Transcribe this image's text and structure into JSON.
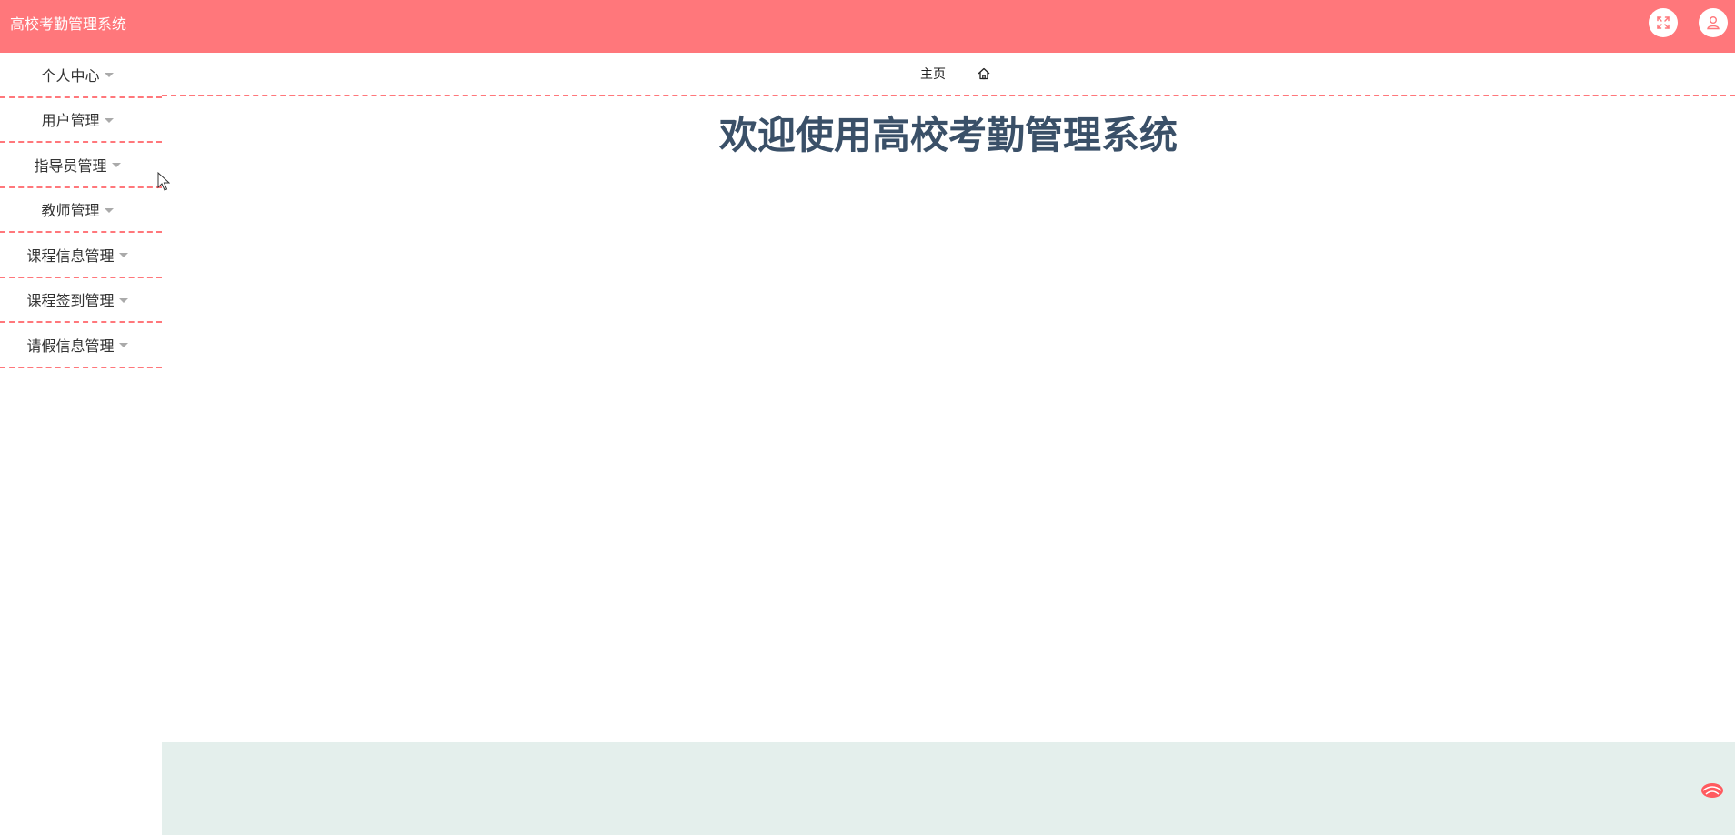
{
  "app": {
    "title": "高校考勤管理系统"
  },
  "header": {
    "fullscreen_icon": "fullscreen-icon",
    "user_icon": "user-icon"
  },
  "sidebar": {
    "items": [
      {
        "label": "个人中心"
      },
      {
        "label": "用户管理"
      },
      {
        "label": "指导员管理"
      },
      {
        "label": "教师管理"
      },
      {
        "label": "课程信息管理"
      },
      {
        "label": "课程签到管理"
      },
      {
        "label": "请假信息管理"
      }
    ]
  },
  "breadcrumb": {
    "home_label": "主页",
    "home_icon": "home-icon"
  },
  "main": {
    "welcome": "欢迎使用高校考勤管理系统"
  },
  "colors": {
    "accent": "#ff777b",
    "heading": "#3a5068",
    "footer_band": "#e4efec"
  }
}
